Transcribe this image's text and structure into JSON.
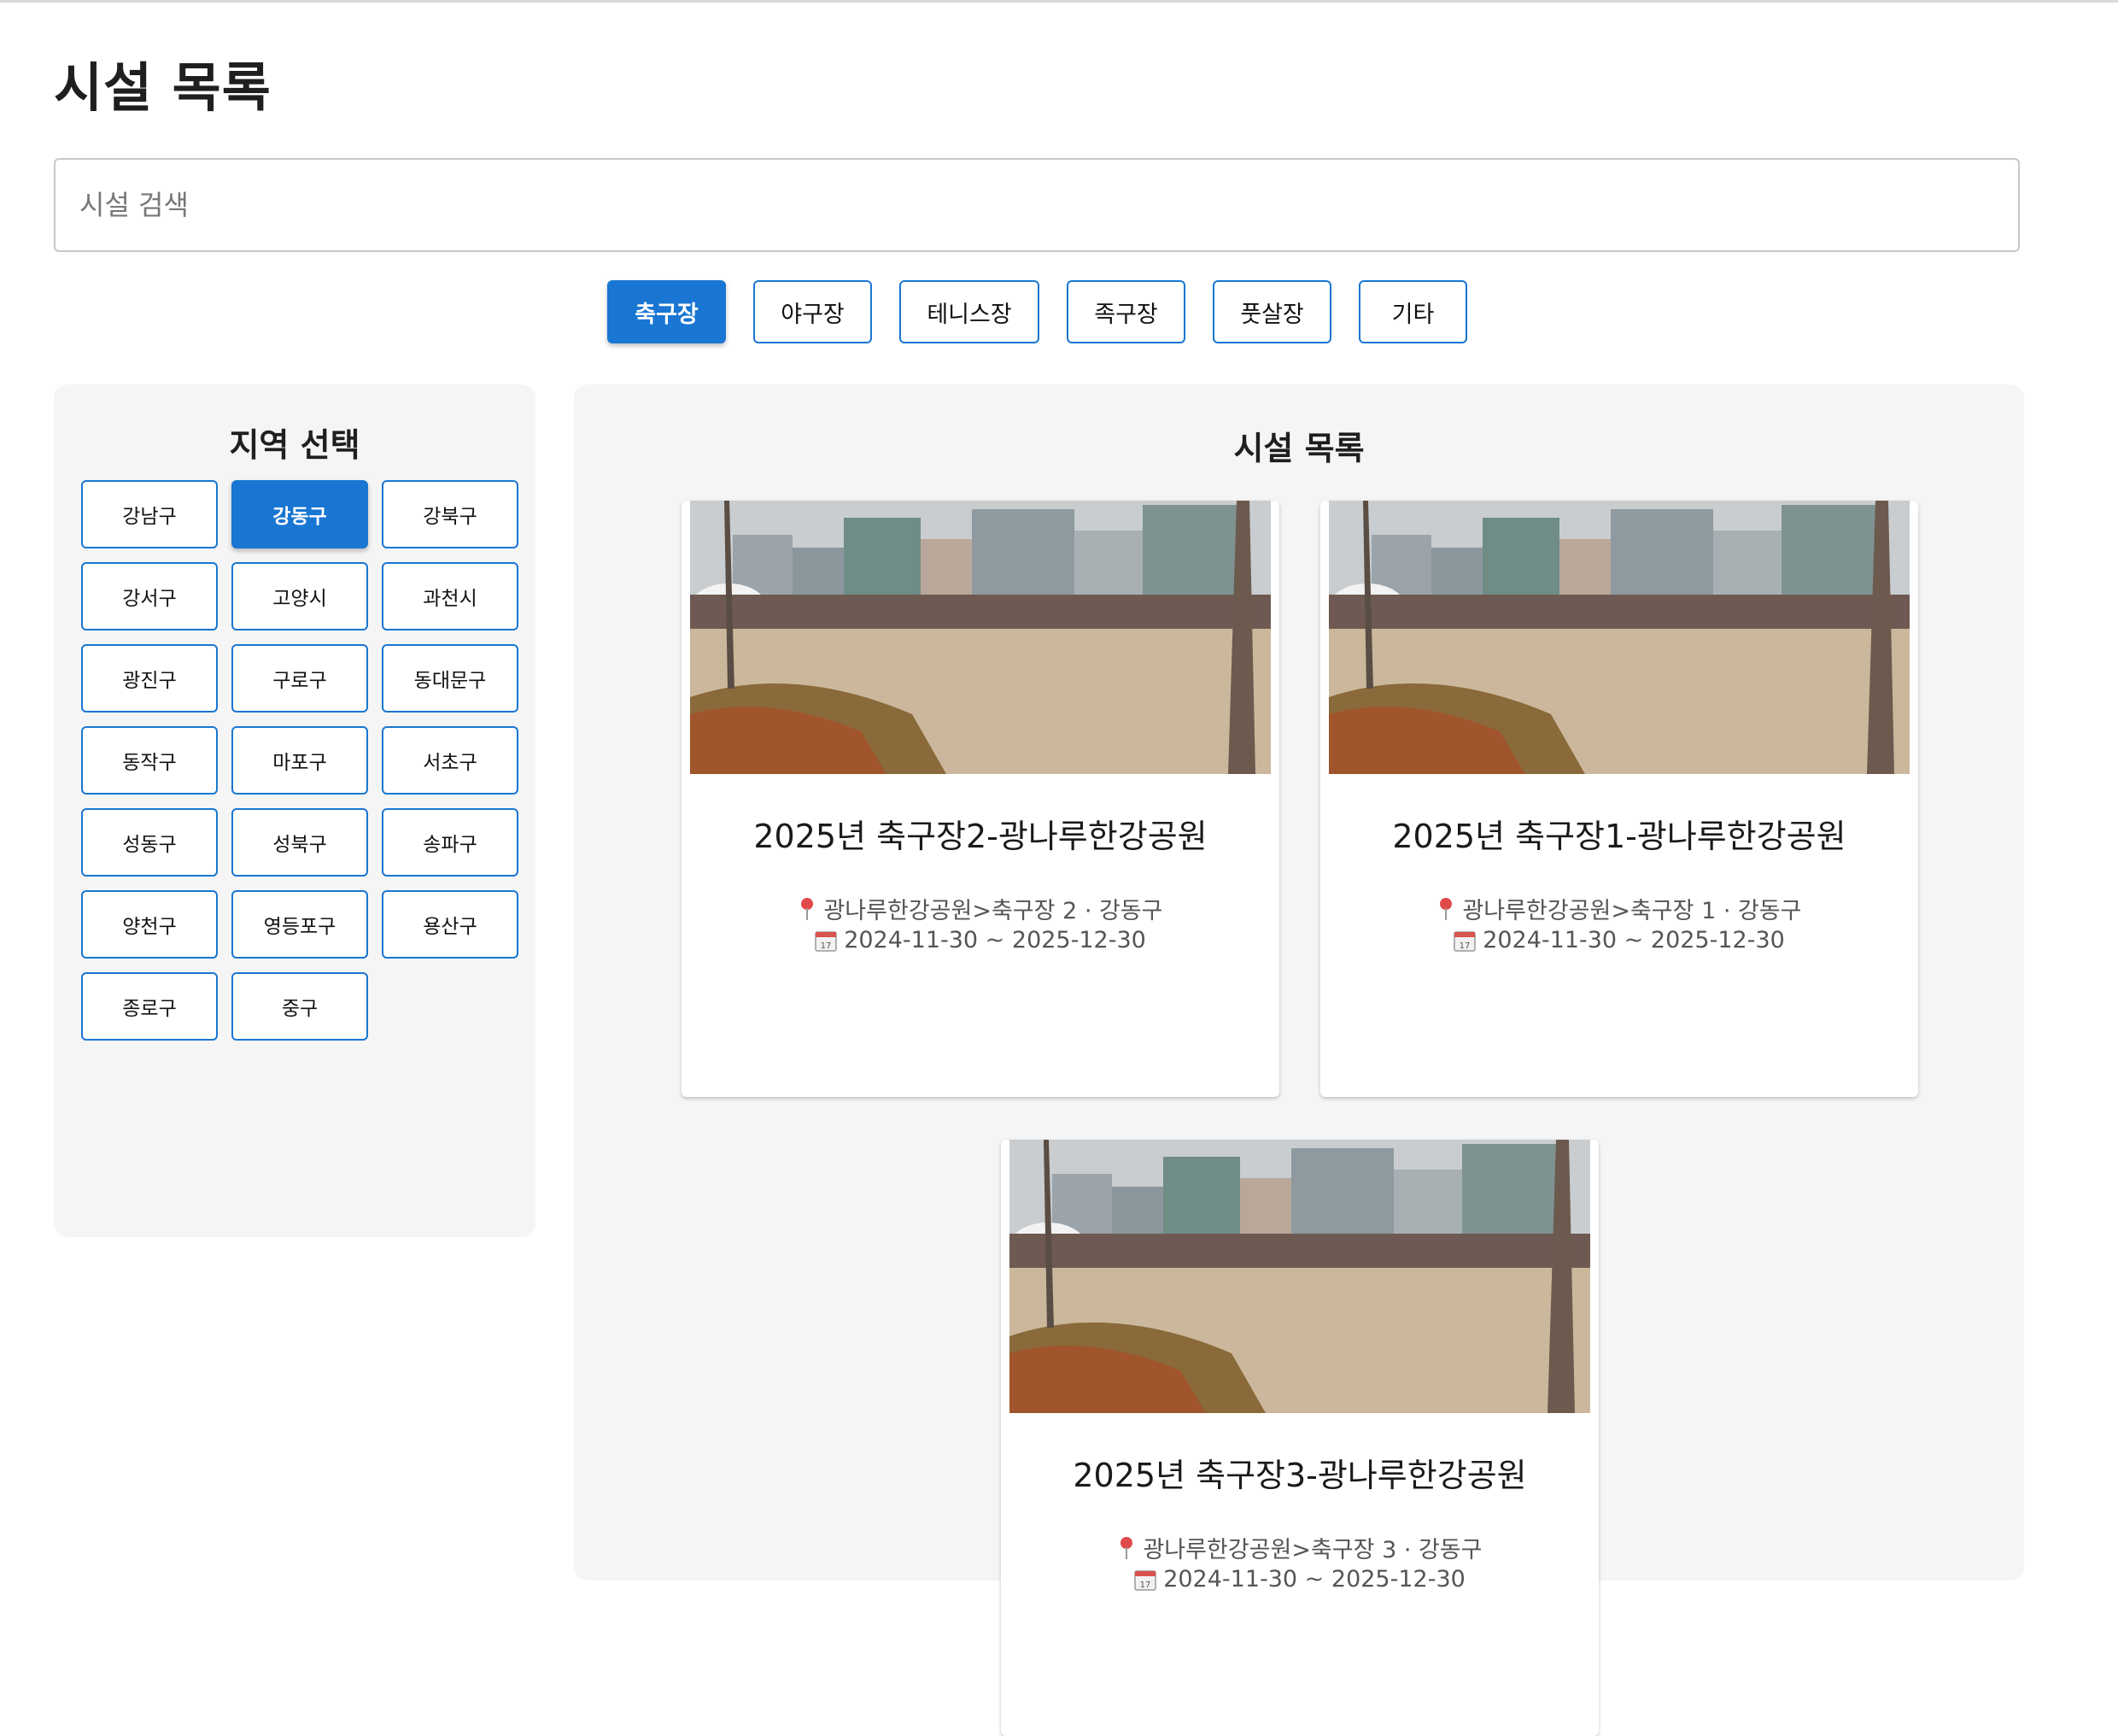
{
  "page": {
    "title": "시설 목록"
  },
  "search": {
    "placeholder": "시설 검색",
    "value": ""
  },
  "categories": [
    {
      "label": "축구장",
      "active": true
    },
    {
      "label": "야구장",
      "active": false
    },
    {
      "label": "테니스장",
      "active": false
    },
    {
      "label": "족구장",
      "active": false
    },
    {
      "label": "풋살장",
      "active": false
    },
    {
      "label": "기타",
      "active": false
    }
  ],
  "regions": {
    "title": "지역 선택",
    "selected": "강동구",
    "items": [
      {
        "label": "강남구"
      },
      {
        "label": "강동구"
      },
      {
        "label": "강북구"
      },
      {
        "label": "강서구"
      },
      {
        "label": "고양시"
      },
      {
        "label": "과천시"
      },
      {
        "label": "광진구"
      },
      {
        "label": "구로구"
      },
      {
        "label": "동대문구"
      },
      {
        "label": "동작구"
      },
      {
        "label": "마포구"
      },
      {
        "label": "서초구"
      },
      {
        "label": "성동구"
      },
      {
        "label": "성북구"
      },
      {
        "label": "송파구"
      },
      {
        "label": "양천구"
      },
      {
        "label": "영등포구"
      },
      {
        "label": "용산구"
      },
      {
        "label": "종로구"
      },
      {
        "label": "중구"
      }
    ]
  },
  "facilities": {
    "title": "시설 목록",
    "items": [
      {
        "name": "2025년 축구장2-광나루한강공원",
        "location": "광나루한강공원>축구장 2 · 강동구",
        "period": "2024-11-30 ~ 2025-12-30"
      },
      {
        "name": "2025년 축구장1-광나루한강공원",
        "location": "광나루한강공원>축구장 1 · 강동구",
        "period": "2024-11-30 ~ 2025-12-30"
      },
      {
        "name": "2025년 축구장3-광나루한강공원",
        "location": "광나루한강공원>축구장 3 · 강동구",
        "period": "2024-11-30 ~ 2025-12-30"
      }
    ]
  },
  "icons": {
    "location": "map-pin-icon",
    "date": "calendar-icon"
  },
  "colors": {
    "accent": "#1976d2",
    "panel_bg": "#f5f5f5",
    "pin": "#e04a4a"
  }
}
